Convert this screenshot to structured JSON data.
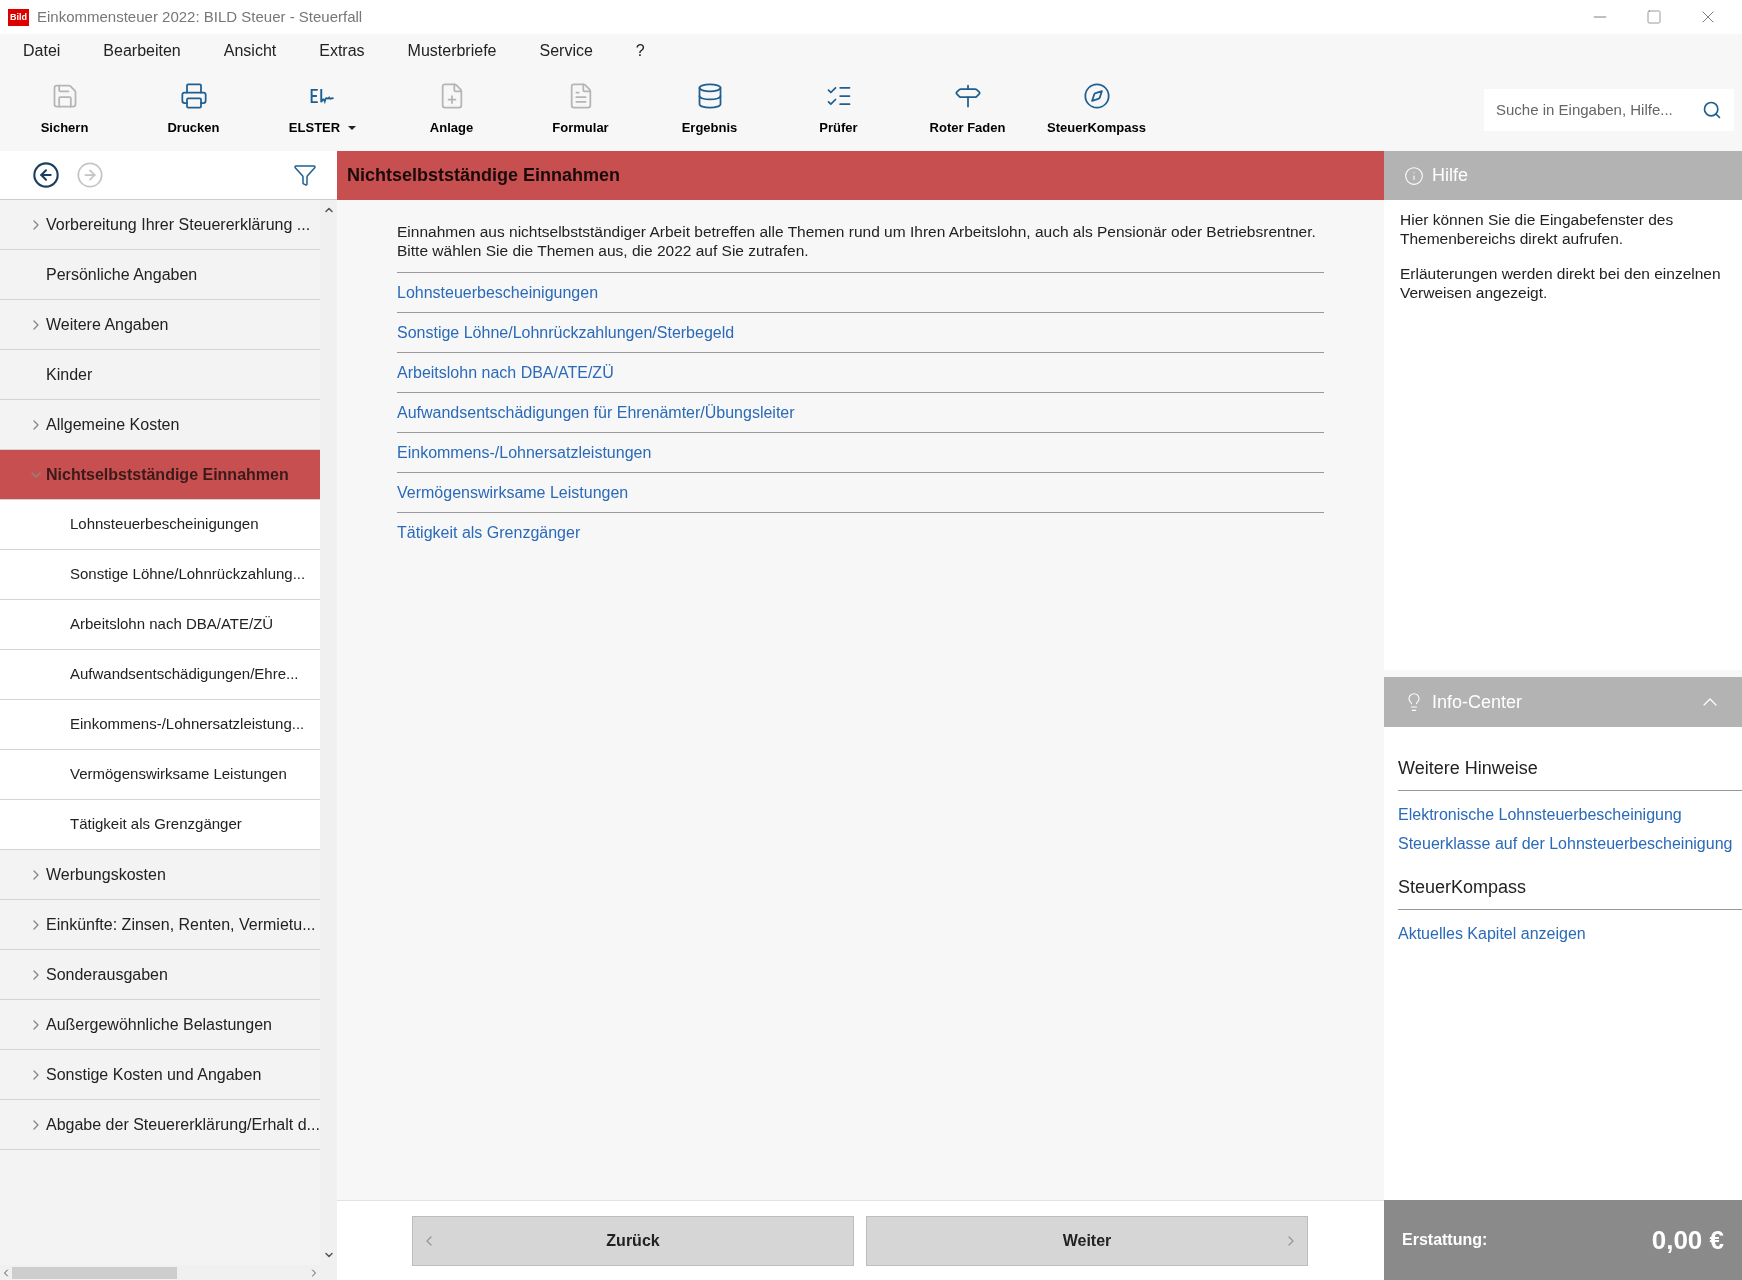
{
  "window": {
    "logo": "Bild",
    "title": "Einkommensteuer 2022: BILD Steuer - Steuerfall"
  },
  "menu": [
    "Datei",
    "Bearbeiten",
    "Ansicht",
    "Extras",
    "Musterbriefe",
    "Service",
    "?"
  ],
  "toolbar": [
    {
      "kind": "save",
      "label": "Sichern",
      "disabled": true
    },
    {
      "kind": "print",
      "label": "Drucken",
      "disabled": false
    },
    {
      "kind": "elster",
      "label": "ELSTER",
      "disabled": false,
      "dropdown": true
    },
    {
      "kind": "attach",
      "label": "Anlage",
      "disabled": true
    },
    {
      "kind": "form",
      "label": "Formular",
      "disabled": true
    },
    {
      "kind": "result",
      "label": "Ergebnis",
      "disabled": false
    },
    {
      "kind": "check",
      "label": "Prüfer",
      "disabled": false
    },
    {
      "kind": "signpost",
      "label": "Roter Faden",
      "disabled": false
    },
    {
      "kind": "compass",
      "label": "SteuerKompass",
      "disabled": false
    }
  ],
  "search": {
    "placeholder": "Suche in Eingaben, Hilfe..."
  },
  "sidebar": {
    "back_disabled": false,
    "forward_disabled": true,
    "items": [
      {
        "kind": "group",
        "label": "Vorbereitung Ihrer Steuererklärung ...",
        "expanded": false,
        "selected": false
      },
      {
        "kind": "leaf",
        "label": "Persönliche Angaben",
        "selected": false
      },
      {
        "kind": "group",
        "label": "Weitere Angaben",
        "expanded": false,
        "selected": false
      },
      {
        "kind": "leaf",
        "label": "Kinder",
        "selected": false
      },
      {
        "kind": "group",
        "label": "Allgemeine Kosten",
        "expanded": false,
        "selected": false
      },
      {
        "kind": "group",
        "label": "Nichtselbstständige Einnahmen",
        "expanded": true,
        "selected": true,
        "children": [
          {
            "label": "Lohnsteuerbescheinigungen",
            "selected": false
          },
          {
            "label": "Sonstige Löhne/Lohnrückzahlung...",
            "selected": false
          },
          {
            "label": "Arbeitslohn nach DBA/ATE/ZÜ",
            "selected": false
          },
          {
            "label": "Aufwandsentschädigungen/Ehre...",
            "selected": false
          },
          {
            "label": "Einkommens-/Lohnersatzleistung...",
            "selected": false
          },
          {
            "label": "Vermögenswirksame Leistungen",
            "selected": false
          },
          {
            "label": "Tätigkeit als Grenzgänger",
            "selected": false
          }
        ]
      },
      {
        "kind": "group",
        "label": "Werbungskosten",
        "expanded": false,
        "selected": false
      },
      {
        "kind": "group",
        "label": "Einkünfte: Zinsen, Renten, Vermietu...",
        "expanded": false,
        "selected": false
      },
      {
        "kind": "group",
        "label": "Sonderausgaben",
        "expanded": false,
        "selected": false
      },
      {
        "kind": "group",
        "label": "Außergewöhnliche Belastungen",
        "expanded": false,
        "selected": false
      },
      {
        "kind": "group",
        "label": "Sonstige Kosten und Angaben",
        "expanded": false,
        "selected": false
      },
      {
        "kind": "group",
        "label": "Abgabe der Steuererklärung/Erhalt d...",
        "expanded": false,
        "selected": false
      }
    ]
  },
  "main": {
    "title": "Nichtselbstständige Einnahmen",
    "intro": [
      "Einnahmen aus nichtselbstständiger Arbeit betreffen alle Themen rund um Ihren Arbeitslohn, auch als Pensionär oder Betriebsrentner.",
      "Bitte wählen Sie die Themen aus, die 2022 auf Sie zutrafen."
    ],
    "links": [
      "Lohnsteuerbescheinigungen",
      "Sonstige Löhne/Lohnrückzahlungen/Sterbegeld",
      "Arbeitslohn nach DBA/ATE/ZÜ",
      "Aufwandsentschädigungen für Ehrenämter/Übungsleiter",
      "Einkommens-/Lohnersatzleistungen",
      "Vermögenswirksame Leistungen",
      "Tätigkeit als Grenzgänger"
    ],
    "back_button": "Zurück",
    "next_button": "Weiter"
  },
  "help": {
    "title": "Hilfe",
    "paragraphs": [
      "Hier können Sie die Eingabefenster des Themenbereichs direkt aufrufen.",
      "Erläuterungen werden direkt bei den einzelnen Verweisen angezeigt."
    ]
  },
  "info_center": {
    "title": "Info-Center",
    "expanded": true,
    "sections": [
      {
        "heading": "Weitere Hinweise",
        "links": [
          "Elektronische Lohnsteuerbescheinigung",
          "Steuerklasse auf der Lohnsteuerbescheinigung"
        ]
      },
      {
        "heading": "SteuerKompass",
        "links": [
          "Aktuelles Kapitel anzeigen"
        ]
      }
    ]
  },
  "refund": {
    "label": "Erstattung:",
    "value": "0,00 €"
  }
}
